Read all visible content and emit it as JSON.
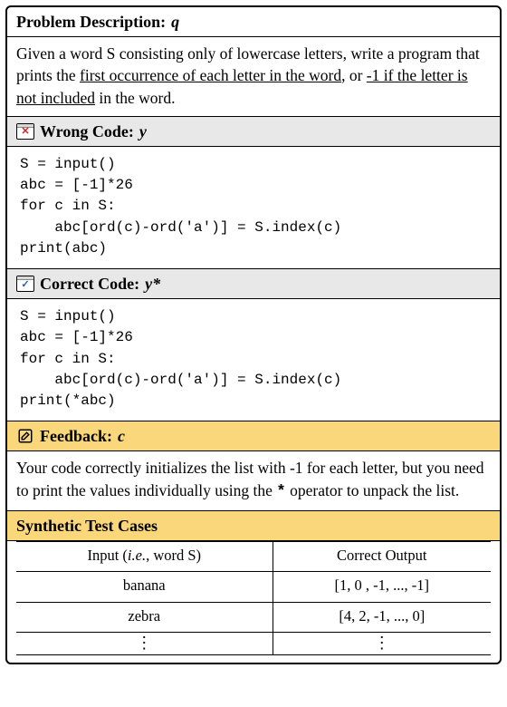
{
  "problem": {
    "header_label": "Problem Description:",
    "header_var": "q",
    "text_pre": "Given a word S consisting only of lowercase letters, write a program that prints the ",
    "text_u1": "first occurrence of each letter in the word",
    "text_mid": ", or ",
    "text_u2": "-1 if the letter is not included",
    "text_post": " in the word."
  },
  "wrong": {
    "header_label": "Wrong Code:",
    "header_var": "y",
    "code": "S = input()\nabc = [-1]*26\nfor c in S:\n    abc[ord(c)-ord('a')] = S.index(c)\nprint(abc)"
  },
  "correct": {
    "header_label": "Correct Code:",
    "header_var": "y*",
    "code": "S = input()\nabc = [-1]*26\nfor c in S:\n    abc[ord(c)-ord('a')] = S.index(c)\nprint(*abc)"
  },
  "feedback": {
    "header_label": "Feedback:",
    "header_var": "c",
    "text_pre": "Your code correctly initializes the list with -1 for each letter, but you need to print the values individually using the ",
    "operator": "*",
    "text_post": " operator to unpack the list."
  },
  "tests": {
    "header_label": "Synthetic Test Cases",
    "col_input_pre": "Input (",
    "col_input_ie": "i.e.",
    "col_input_post": ", word S)",
    "col_output": "Correct Output",
    "rows": [
      {
        "input": "banana",
        "output": "[1, 0 , -1, ..., -1]"
      },
      {
        "input": "zebra",
        "output": "[4, 2, -1, ..., 0]"
      }
    ],
    "vdots": "⋮"
  }
}
